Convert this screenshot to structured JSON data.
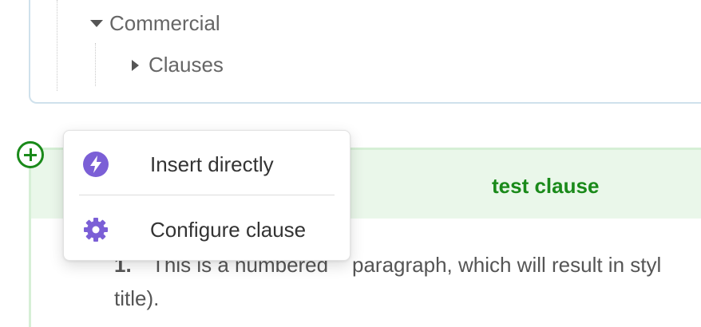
{
  "tree": {
    "items": [
      {
        "label": "Commercial",
        "state": "expanded"
      },
      {
        "label": "Clauses",
        "state": "collapsed"
      }
    ]
  },
  "clause": {
    "title": "test clause",
    "paragraph_number": "1.",
    "paragraph_line1_hidden": "This is a numbered",
    "paragraph_line1_visible": "paragraph, which will result in styl",
    "paragraph_line2": "title)."
  },
  "menu": {
    "items": [
      {
        "label": "Insert directly",
        "icon": "lightning-icon"
      },
      {
        "label": "Configure clause",
        "icon": "gear-icon"
      }
    ]
  },
  "colors": {
    "accent_green": "#1a8a1a",
    "header_bg": "#eaf7ea",
    "menu_icon_purple": "#7b5fd6"
  }
}
